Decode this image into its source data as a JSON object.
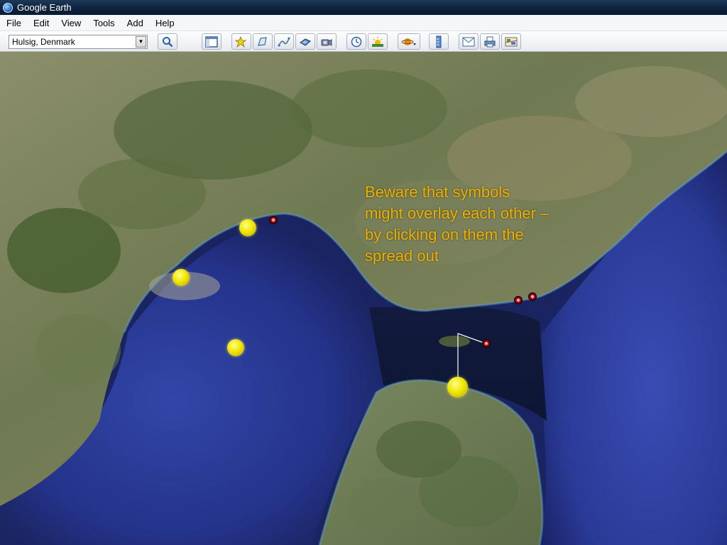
{
  "window": {
    "title": "Google Earth"
  },
  "menu": [
    "File",
    "Edit",
    "View",
    "Tools",
    "Add",
    "Help"
  ],
  "toolbar": {
    "search_value": "Hulsig, Denmark",
    "buttons": [
      {
        "name": "search-button",
        "icon": "magnifier-icon"
      },
      {
        "name": "sidebar-toggle-button",
        "icon": "sidebar-icon"
      },
      {
        "name": "add-placemark-button",
        "icon": "pushpin-icon"
      },
      {
        "name": "add-polygon-button",
        "icon": "polygon-icon"
      },
      {
        "name": "add-path-button",
        "icon": "path-icon"
      },
      {
        "name": "add-image-overlay-button",
        "icon": "image-overlay-icon"
      },
      {
        "name": "record-tour-button",
        "icon": "tour-camera-icon"
      },
      {
        "name": "historical-imagery-button",
        "icon": "clock-icon"
      },
      {
        "name": "sunlight-button",
        "icon": "sun-icon"
      },
      {
        "name": "switch-planet-button",
        "icon": "planet-icon"
      },
      {
        "name": "ruler-button",
        "icon": "ruler-icon"
      },
      {
        "name": "email-button",
        "icon": "envelope-icon"
      },
      {
        "name": "print-button",
        "icon": "printer-icon"
      },
      {
        "name": "view-in-maps-button",
        "icon": "map-icon"
      }
    ]
  },
  "annotation": {
    "text": "Beware that symbols might overlay each other – by clicking on them the spread out",
    "color": "#f0b000"
  },
  "colors": {
    "title_bar": "#0f2440",
    "sea_deep": "#1c2d7a",
    "land": "#6f7a58",
    "placemark_yellow": "#f2e600",
    "placemark_red": "#c0101a"
  }
}
